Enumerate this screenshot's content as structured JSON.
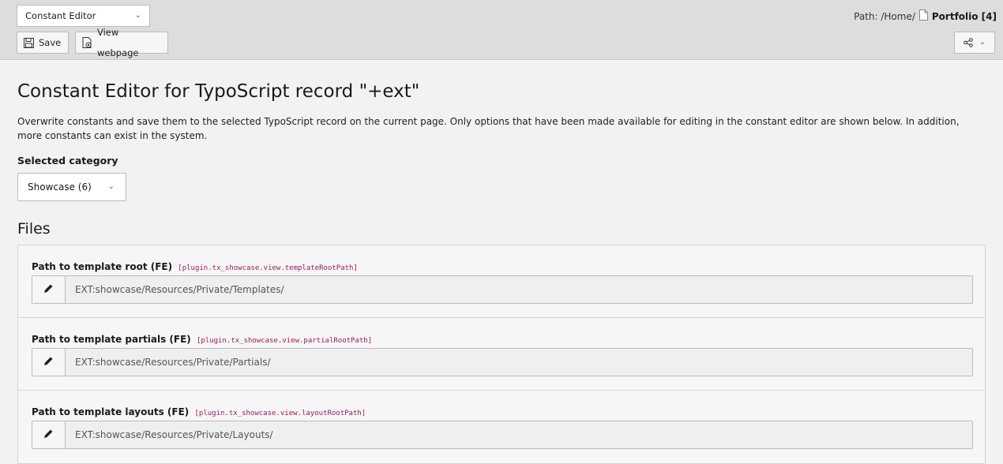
{
  "header": {
    "module_select": "Constant Editor",
    "save_label": "Save",
    "view_label": "View webpage",
    "path_prefix": "Path: /Home/",
    "path_record": "Portfolio [4]"
  },
  "main": {
    "title": "Constant Editor for TypoScript record \"+ext\"",
    "description": "Overwrite constants and save them to the selected TypoScript record on the current page. Only options that have been made available for editing in the constant editor are shown below. In addition, more constants can exist in the system.",
    "category_label": "Selected category",
    "category_value": "Showcase (6)",
    "section_title": "Files",
    "rows": [
      {
        "label": "Path to template root (FE)",
        "key": "[plugin.tx_showcase.view.templateRootPath]",
        "value": "EXT:showcase/Resources/Private/Templates/"
      },
      {
        "label": "Path to template partials (FE)",
        "key": "[plugin.tx_showcase.view.partialRootPath]",
        "value": "EXT:showcase/Resources/Private/Partials/"
      },
      {
        "label": "Path to template layouts (FE)",
        "key": "[plugin.tx_showcase.view.layoutRootPath]",
        "value": "EXT:showcase/Resources/Private/Layouts/"
      }
    ]
  },
  "icons": {
    "save": "save-icon",
    "view": "view-webpage-icon",
    "share": "share-icon",
    "page": "page-icon",
    "edit": "pencil-icon",
    "chevron": "chevron-down-icon"
  },
  "colors": {
    "header_bg": "#dddddd",
    "page_bg": "#f2f2f2",
    "key_color": "#a0195c"
  }
}
